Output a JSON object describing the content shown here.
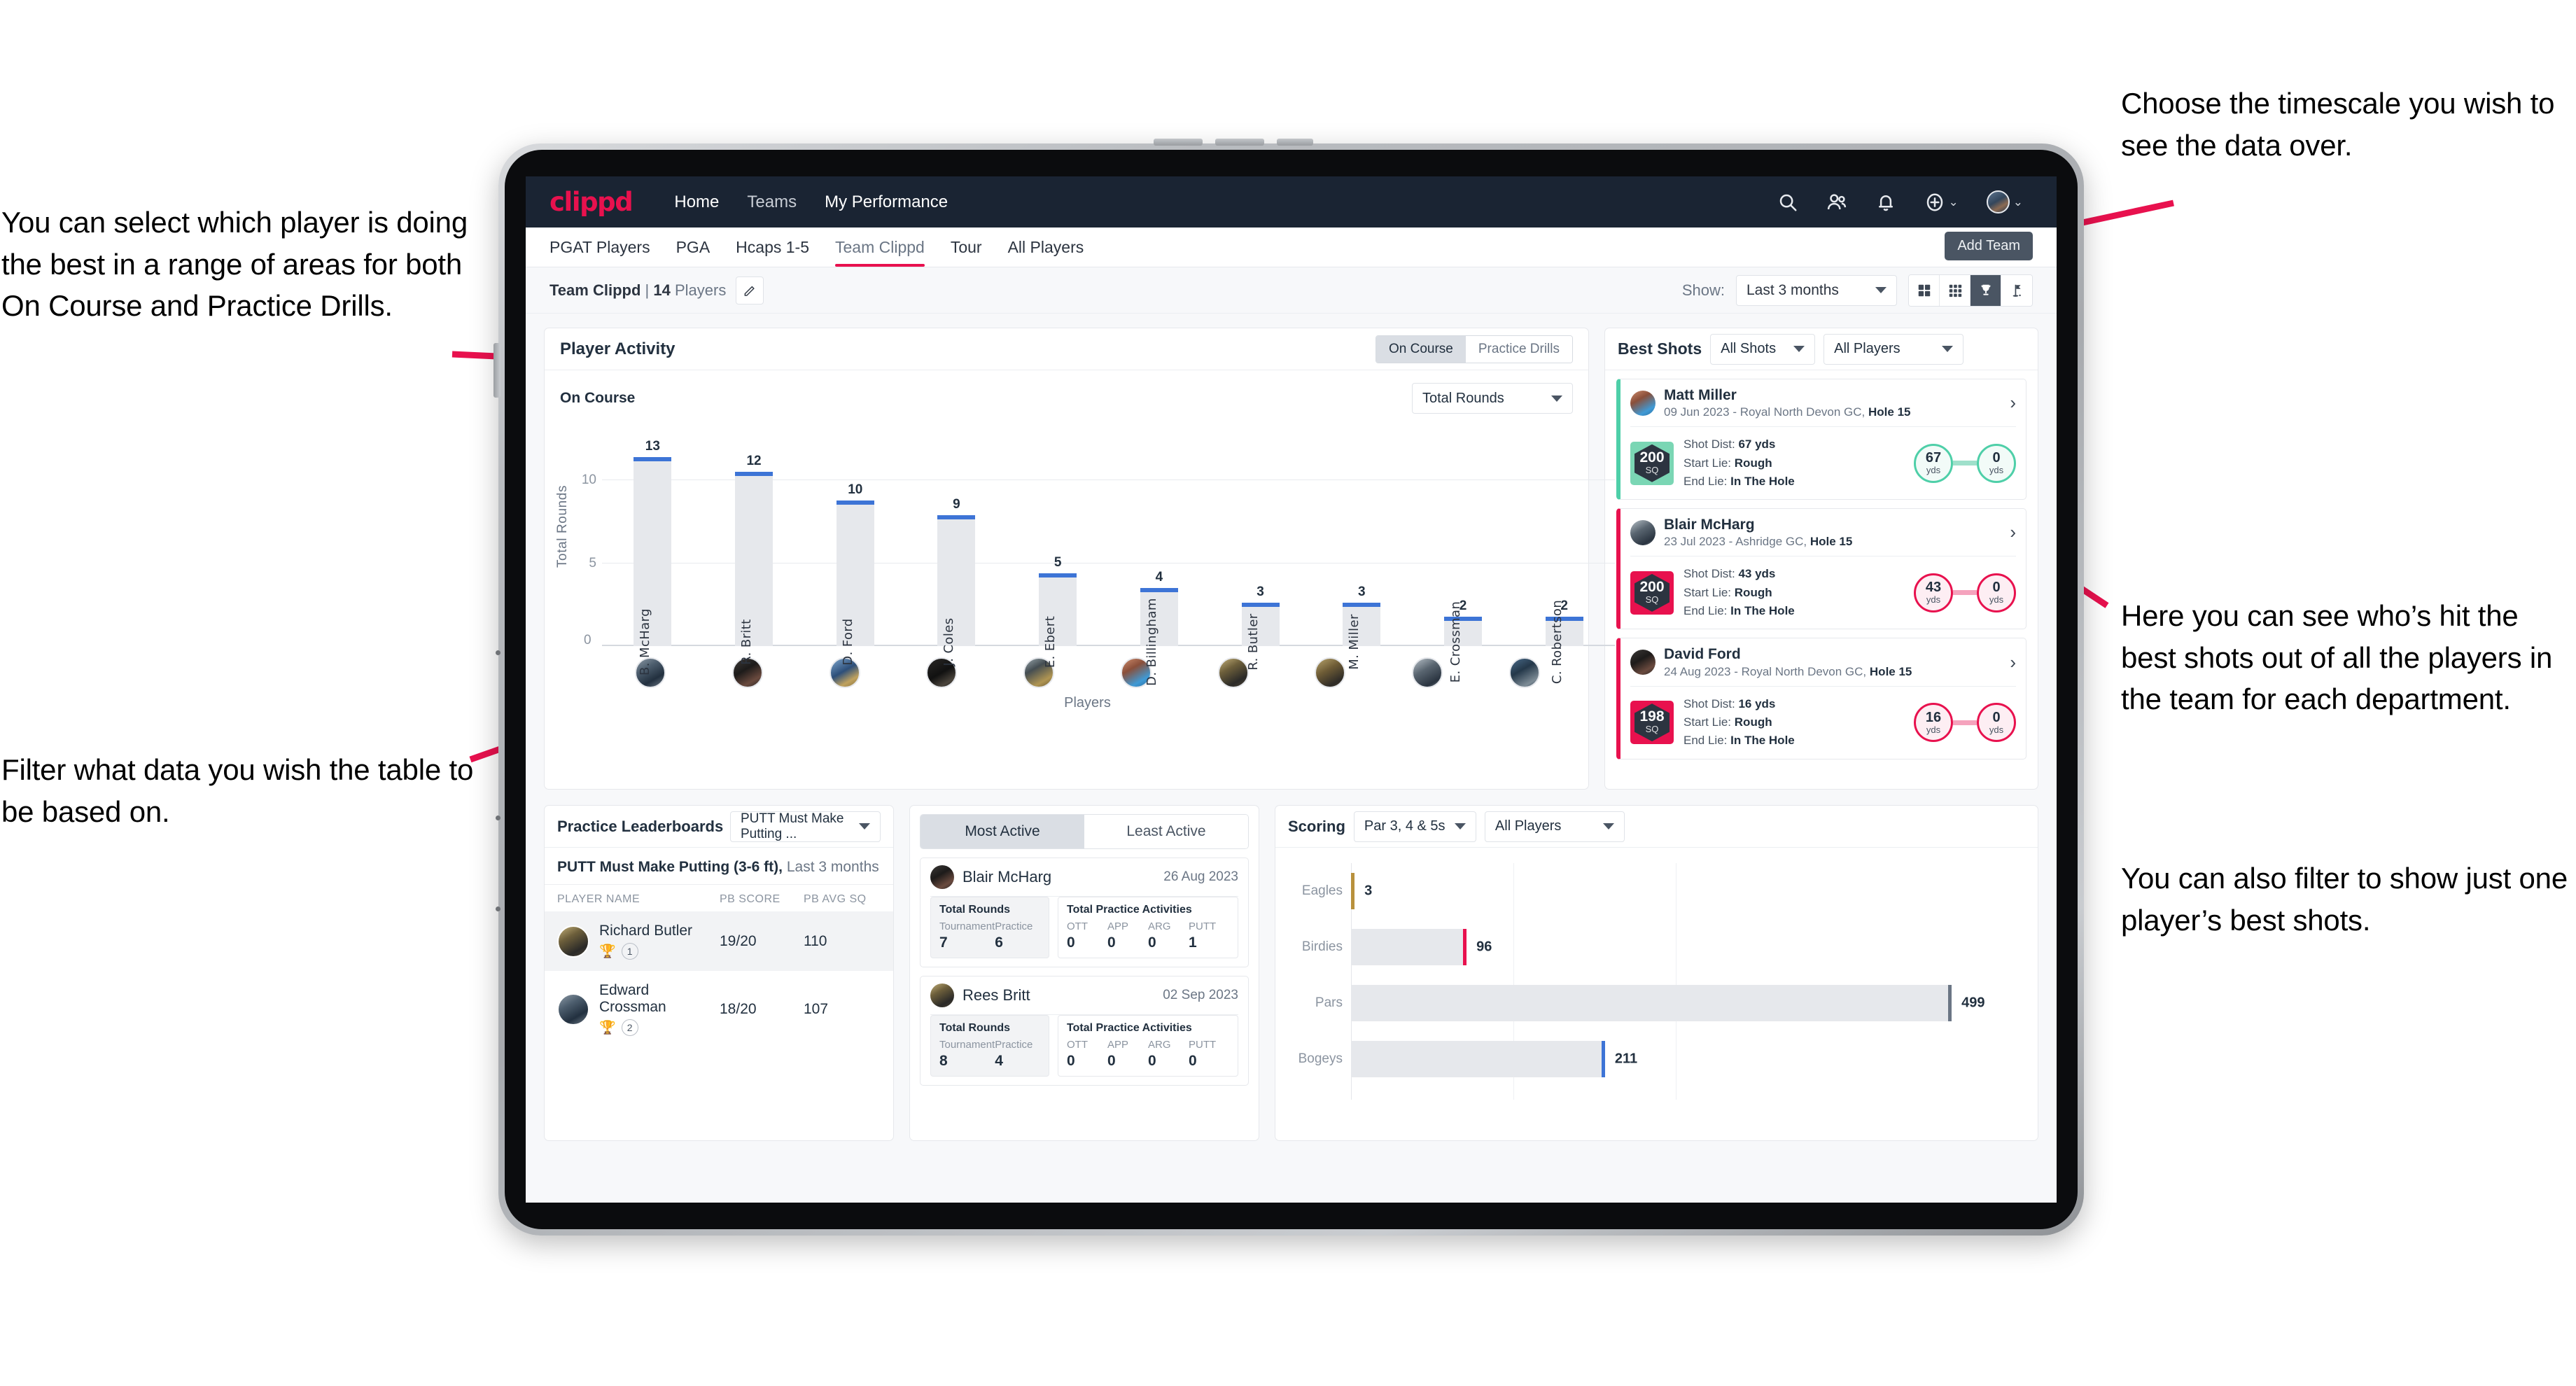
{
  "annotations": {
    "left_top": "You can select which player is doing the best in a range of areas for both On Course and Practice Drills.",
    "left_bottom": "Filter what data you wish the table to be based on.",
    "right_top": "Choose the timescale you wish to see the data over.",
    "right_mid": "Here you can see who’s hit the best shots out of all the players in the team for each department.",
    "right_bottom": "You can also filter to show just one player’s best shots."
  },
  "topnav": {
    "logo": "clippd",
    "links": [
      {
        "label": "Home",
        "active": true
      },
      {
        "label": "Teams",
        "active": false
      },
      {
        "label": "My Performance",
        "active": true
      }
    ],
    "icons": [
      "search-icon",
      "people-icon",
      "bell-icon",
      "plus-circle-icon",
      "avatar"
    ]
  },
  "tabs": [
    {
      "label": "PGAT Players",
      "active": false
    },
    {
      "label": "PGA",
      "active": false
    },
    {
      "label": "Hcaps 1-5",
      "active": false
    },
    {
      "label": "Team Clippd",
      "active": true
    },
    {
      "label": "Tour",
      "active": false
    },
    {
      "label": "All Players",
      "active": false
    }
  ],
  "tooltip": {
    "add_team": "Add Team"
  },
  "subbar": {
    "team_name": "Team Clippd",
    "separator": "|",
    "player_count": "14",
    "players_word": "Players",
    "edit_icon": "pencil-icon",
    "show_label": "Show:",
    "range_value": "Last 3 months",
    "view_modes": [
      {
        "name": "grid-2x2-icon",
        "active": false
      },
      {
        "name": "grid-3x3-icon",
        "active": false
      },
      {
        "name": "trophy-icon",
        "active": true
      },
      {
        "name": "golf-flag-icon",
        "active": false
      }
    ]
  },
  "player_activity": {
    "title": "Player Activity",
    "segments": [
      {
        "label": "On Course",
        "active": true
      },
      {
        "label": "Practice Drills",
        "active": false
      }
    ],
    "sub_label": "On Course",
    "metric_dropdown": "Total Rounds",
    "x_axis_label": "Players"
  },
  "chart_data": [
    {
      "type": "bar",
      "title": "Player Activity — On Course",
      "xlabel": "Players",
      "ylabel": "Total Rounds",
      "ylim": [
        0,
        13
      ],
      "yticks": [
        0,
        5,
        10
      ],
      "grid": true,
      "categories": [
        "B. McHarg",
        "R. Britt",
        "D. Ford",
        "J. Coles",
        "E. Ebert",
        "D. Billingham",
        "R. Butler",
        "M. Miller",
        "E. Crossman",
        "C. Robertson"
      ],
      "values": [
        13,
        12,
        10,
        9,
        5,
        4,
        3,
        3,
        2,
        2
      ]
    },
    {
      "type": "bar",
      "orientation": "horizontal",
      "title": "Scoring",
      "categories": [
        "Eagles",
        "Birdies",
        "Pars",
        "Bogeys"
      ],
      "values": [
        3,
        96,
        499,
        211
      ],
      "colors": [
        "#b8913c",
        "#e8114e",
        "#6b7685",
        "#3d74d6"
      ],
      "xlim": [
        0,
        560
      ],
      "grid": true
    }
  ],
  "best_shots": {
    "title": "Best Shots",
    "shot_filter": "All Shots",
    "player_filter": "All Players",
    "cards": [
      {
        "name": "Matt Miller",
        "meta_date": "09 Jun 2023",
        "meta_course": "Royal North Devon GC,",
        "meta_hole": "Hole 15",
        "badge_value": "200",
        "badge_unit": "SQ",
        "shot_dist_label": "Shot Dist:",
        "shot_dist": "67 yds",
        "start_lie_label": "Start Lie:",
        "start_lie": "Rough",
        "end_lie_label": "End Lie:",
        "end_lie": "In The Hole",
        "from_value": "67",
        "from_unit": "yds",
        "to_value": "0",
        "to_unit": "yds",
        "accent": "teal"
      },
      {
        "name": "Blair McHarg",
        "meta_date": "23 Jul 2023",
        "meta_course": "Ashridge GC,",
        "meta_hole": "Hole 15",
        "badge_value": "200",
        "badge_unit": "SQ",
        "shot_dist_label": "Shot Dist:",
        "shot_dist": "43 yds",
        "start_lie_label": "Start Lie:",
        "start_lie": "Rough",
        "end_lie_label": "End Lie:",
        "end_lie": "In The Hole",
        "from_value": "43",
        "from_unit": "yds",
        "to_value": "0",
        "to_unit": "yds",
        "accent": "pink"
      },
      {
        "name": "David Ford",
        "meta_date": "24 Aug 2023",
        "meta_course": "Royal North Devon GC,",
        "meta_hole": "Hole 15",
        "badge_value": "198",
        "badge_unit": "SQ",
        "shot_dist_label": "Shot Dist:",
        "shot_dist": "16 yds",
        "start_lie_label": "Start Lie:",
        "start_lie": "Rough",
        "end_lie_label": "End Lie:",
        "end_lie": "In The Hole",
        "from_value": "16",
        "from_unit": "yds",
        "to_value": "0",
        "to_unit": "yds",
        "accent": "pink"
      }
    ]
  },
  "practice_leaderboards": {
    "title": "Practice Leaderboards",
    "dropdown": "PUTT Must Make Putting ...",
    "subtitle_bold": "PUTT Must Make Putting (3-6 ft),",
    "subtitle_rest": "Last 3 months",
    "columns": [
      "PLAYER NAME",
      "PB SCORE",
      "PB AVG SQ"
    ],
    "rows": [
      {
        "name": "Richard Butler",
        "rank": "1",
        "trophy": "gold",
        "pb_score": "19/20",
        "pb_avg_sq": "110",
        "highlight": true
      },
      {
        "name": "Edward Crossman",
        "rank": "2",
        "trophy": "silver",
        "pb_score": "18/20",
        "pb_avg_sq": "107",
        "highlight": false
      }
    ]
  },
  "activity": {
    "tabs": [
      {
        "label": "Most Active",
        "active": true
      },
      {
        "label": "Least Active",
        "active": false
      }
    ],
    "rounds_title": "Total Rounds",
    "rounds_cols": [
      "Tournament",
      "Practice"
    ],
    "practice_title": "Total Practice Activities",
    "practice_cols": [
      "OTT",
      "APP",
      "ARG",
      "PUTT"
    ],
    "cards": [
      {
        "name": "Blair McHarg",
        "date": "26 Aug 2023",
        "tournament": "7",
        "practice": "6",
        "ott": "0",
        "app": "0",
        "arg": "0",
        "putt": "1"
      },
      {
        "name": "Rees Britt",
        "date": "02 Sep 2023",
        "tournament": "8",
        "practice": "4",
        "ott": "0",
        "app": "0",
        "arg": "0",
        "putt": "0"
      }
    ]
  },
  "scoring": {
    "title": "Scoring",
    "par_filter": "Par 3, 4 & 5s",
    "player_filter": "All Players"
  },
  "colors": {
    "brand_pink": "#e8114e",
    "nav_dark": "#1a2433",
    "bar_blue": "#3d74d6",
    "teal": "#4ecfa8",
    "page_bg": "#f7f8fa"
  }
}
